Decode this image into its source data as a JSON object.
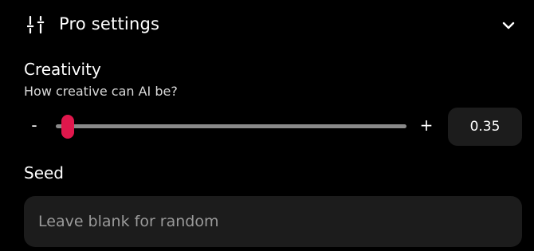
{
  "header": {
    "icon": "sliders-icon",
    "title": "Pro settings",
    "toggle_icon": "chevron-down-icon"
  },
  "creativity": {
    "title": "Creativity",
    "subtitle": "How creative can AI be?",
    "decrement_label": "-",
    "increment_label": "+",
    "min": 0,
    "max": 1,
    "value": 0.02,
    "value_display": "0.35"
  },
  "seed": {
    "title": "Seed",
    "placeholder": "Leave blank for random",
    "value": ""
  },
  "colors": {
    "background": "#000000",
    "accent": "#e0174c",
    "surface": "#1c1c1c",
    "track": "#8a8a8a"
  }
}
